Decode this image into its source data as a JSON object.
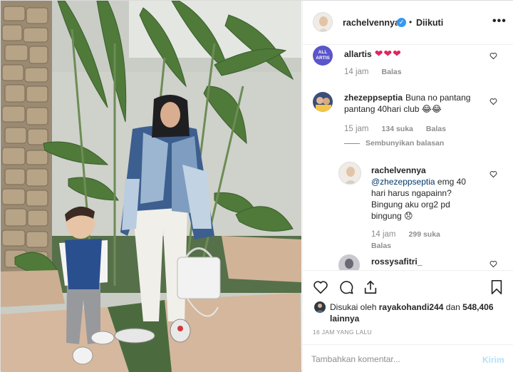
{
  "header": {
    "username": "rachelvennya",
    "verified_badge": "✓",
    "separator": "•",
    "follow_status": "Diikuti",
    "more_options": "•••"
  },
  "comments": [
    {
      "avatar_text": "ALL ARTIS",
      "username": "allartis",
      "text": "❤❤❤",
      "time": "14 jam",
      "reply_label": "Balas"
    },
    {
      "username": "zhezeppseptia",
      "text": "Buna no pantang pantang 40hari club 😂😂",
      "time": "15 jam",
      "likes": "134 suka",
      "reply_label": "Balas",
      "hide_replies": "Sembunyikan balasan"
    },
    {
      "username": "rachelvennya",
      "mention": "@zhezeppseptia",
      "text": "emg 40 hari harus ngapainn? Bingung aku org2 pd bingung 😞",
      "time": "14 jam",
      "likes": "299 suka",
      "reply_label": "Balas"
    },
    {
      "username": "rossysafitri_"
    }
  ],
  "likes": {
    "prefix": "Disukai oleh",
    "liker": "rayakohandi244",
    "conj": "dan",
    "count": "548,406",
    "suffix": "lainnya"
  },
  "timestamp": "16 JAM YANG LALU",
  "add_comment": {
    "placeholder": "Tambahkan komentar...",
    "post_label": "Kirim"
  },
  "colors": {
    "accent": "#3897f0",
    "heart": "#e0245e",
    "post_disabled": "#b2dffc"
  }
}
